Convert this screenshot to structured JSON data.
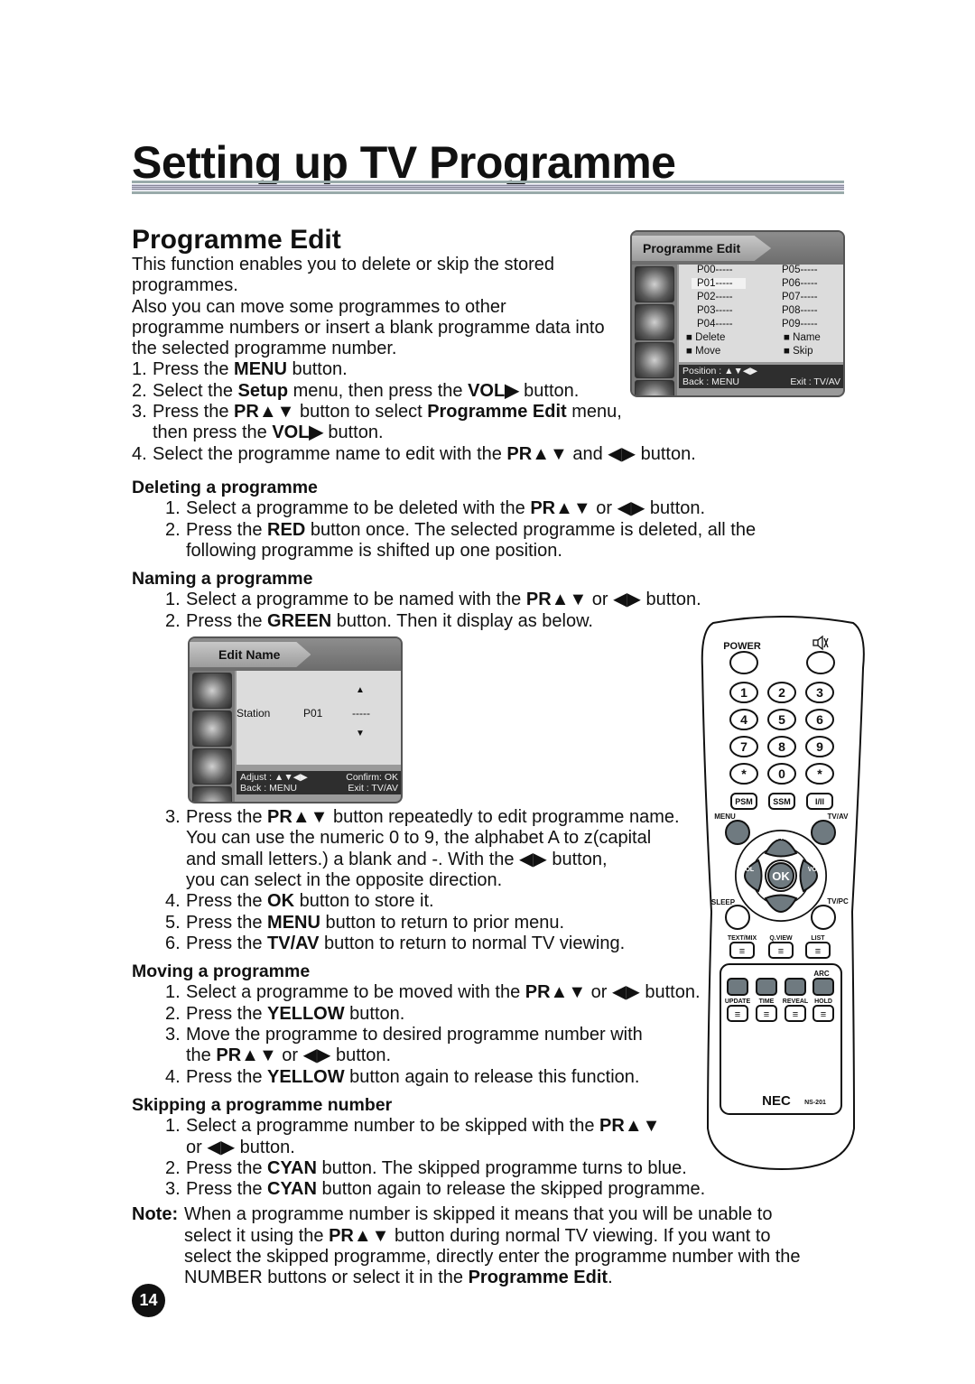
{
  "page_title": "Setting up TV Programme",
  "section_title": "Programme Edit",
  "page_number": "14",
  "body": [
    {
      "type": "para",
      "lines": [
        [
          {
            "t": "This function enables you to delete or skip the stored"
          }
        ],
        [
          {
            "t": "programmes."
          }
        ],
        [
          {
            "t": "Also you can move some programmes to other"
          }
        ],
        [
          {
            "t": "programme numbers or insert a blank programme data into"
          }
        ],
        [
          {
            "t": "the selected programme number."
          }
        ]
      ]
    },
    {
      "type": "list",
      "level": 0,
      "items": [
        {
          "num": "1.",
          "lines": [
            [
              {
                "t": "Press the "
              },
              {
                "t": "MENU",
                "b": true
              },
              {
                "t": " button."
              }
            ]
          ]
        },
        {
          "num": "2.",
          "lines": [
            [
              {
                "t": "Select the "
              },
              {
                "t": "Setup",
                "b": true
              },
              {
                "t": " menu, then press the "
              },
              {
                "t": "VOL▶",
                "b": true
              },
              {
                "t": " button."
              }
            ]
          ]
        },
        {
          "num": "3.",
          "lines": [
            [
              {
                "t": "Press the "
              },
              {
                "t": "PR▲▼",
                "b": true
              },
              {
                "t": " button to select "
              },
              {
                "t": "Programme Edit",
                "b": true
              },
              {
                "t": " menu,"
              }
            ],
            [
              {
                "t": "then press the "
              },
              {
                "t": "VOL▶",
                "b": true
              },
              {
                "t": " button."
              }
            ]
          ]
        },
        {
          "num": "4.",
          "lines": [
            [
              {
                "t": "Select the programme name to edit with the "
              },
              {
                "t": "PR▲▼",
                "b": true
              },
              {
                "t": " and ◀▶ button."
              }
            ]
          ]
        }
      ]
    },
    {
      "type": "heading",
      "text": "Deleting a programme"
    },
    {
      "type": "list",
      "level": 1,
      "items": [
        {
          "num": "1.",
          "lines": [
            [
              {
                "t": "Select a programme to be deleted with the "
              },
              {
                "t": "PR▲▼",
                "b": true
              },
              {
                "t": " or ◀▶ button."
              }
            ]
          ]
        },
        {
          "num": "2.",
          "lines": [
            [
              {
                "t": "Press the "
              },
              {
                "t": "RED",
                "b": true
              },
              {
                "t": " button once. The selected programme is deleted, all the"
              }
            ],
            [
              {
                "t": "following programme is shifted up one position."
              }
            ]
          ]
        }
      ]
    },
    {
      "type": "heading",
      "text": "Naming a programme",
      "tight": true
    },
    {
      "type": "list",
      "level": 1,
      "items": [
        {
          "num": "1.",
          "lines": [
            [
              {
                "t": "Select a programme to be named with the "
              },
              {
                "t": "PR▲▼",
                "b": true
              },
              {
                "t": " or ◀▶ button."
              }
            ]
          ]
        },
        {
          "num": "2.",
          "lines": [
            [
              {
                "t": "Press the "
              },
              {
                "t": "GREEN",
                "b": true
              },
              {
                "t": " button. Then it display as below."
              }
            ]
          ]
        }
      ]
    },
    {
      "type": "figure"
    },
    {
      "type": "list",
      "level": 1,
      "items": [
        {
          "num": "3.",
          "lines": [
            [
              {
                "t": "Press the "
              },
              {
                "t": "PR▲▼",
                "b": true
              },
              {
                "t": " button repeatedly to edit programme name."
              }
            ],
            [
              {
                "t": "You can use the numeric 0 to 9, the alphabet A to z(capital"
              }
            ],
            [
              {
                "t": "and small letters.) a blank and -. With the ◀▶ button,"
              }
            ],
            [
              {
                "t": "you can select in the opposite direction."
              }
            ]
          ]
        },
        {
          "num": "4.",
          "lines": [
            [
              {
                "t": "Press the "
              },
              {
                "t": "OK",
                "b": true
              },
              {
                "t": " button to store it."
              }
            ]
          ]
        },
        {
          "num": "5.",
          "lines": [
            [
              {
                "t": "Press the "
              },
              {
                "t": "MENU",
                "b": true
              },
              {
                "t": " button to return to prior menu."
              }
            ]
          ]
        },
        {
          "num": "6.",
          "lines": [
            [
              {
                "t": "Press the "
              },
              {
                "t": "TV/AV",
                "b": true
              },
              {
                "t": " button to return to normal TV viewing."
              }
            ]
          ]
        }
      ]
    },
    {
      "type": "heading",
      "text": "Moving a programme",
      "tight": true
    },
    {
      "type": "list",
      "level": 1,
      "items": [
        {
          "num": "1.",
          "lines": [
            [
              {
                "t": "Select a programme to be moved with the "
              },
              {
                "t": "PR▲▼",
                "b": true
              },
              {
                "t": " or ◀▶ button."
              }
            ]
          ]
        },
        {
          "num": "2.",
          "lines": [
            [
              {
                "t": "Press the "
              },
              {
                "t": "YELLOW",
                "b": true
              },
              {
                "t": " button."
              }
            ]
          ]
        },
        {
          "num": "3.",
          "lines": [
            [
              {
                "t": "Move the programme to desired programme number with"
              }
            ],
            [
              {
                "t": "the "
              },
              {
                "t": "PR▲▼",
                "b": true
              },
              {
                "t": " or ◀▶ button."
              }
            ]
          ]
        },
        {
          "num": "4.",
          "lines": [
            [
              {
                "t": "Press the "
              },
              {
                "t": "YELLOW",
                "b": true
              },
              {
                "t": " button again to release this function."
              }
            ]
          ]
        }
      ]
    },
    {
      "type": "heading",
      "text": "Skipping a programme number",
      "tight": true
    },
    {
      "type": "list",
      "level": 1,
      "items": [
        {
          "num": "1.",
          "lines": [
            [
              {
                "t": "Select a programme number to be skipped with the "
              },
              {
                "t": "PR▲▼",
                "b": true
              }
            ],
            [
              {
                "t": "or ◀▶ button."
              }
            ]
          ]
        },
        {
          "num": "2.",
          "lines": [
            [
              {
                "t": "Press the "
              },
              {
                "t": "CYAN",
                "b": true
              },
              {
                "t": " button. The skipped programme turns to blue."
              }
            ]
          ]
        },
        {
          "num": "3.",
          "lines": [
            [
              {
                "t": "Press the "
              },
              {
                "t": "CYAN",
                "b": true
              },
              {
                "t": " button again to release the skipped programme."
              }
            ]
          ]
        }
      ]
    },
    {
      "type": "note",
      "label": "Note:",
      "lines": [
        [
          {
            "t": "When a programme number is skipped it means that you will be unable to"
          }
        ],
        [
          {
            "t": "select it using the "
          },
          {
            "t": "PR▲▼",
            "b": true
          },
          {
            "t": " button during normal TV viewing. If you want to"
          }
        ],
        [
          {
            "t": "select the skipped programme, directly enter the programme number with the"
          }
        ],
        [
          {
            "t": "NUMBER buttons or select it in the "
          },
          {
            "t": "Programme Edit",
            "b": true
          },
          {
            "t": "."
          }
        ]
      ]
    }
  ],
  "programme_edit_menu": {
    "title": "Programme Edit",
    "left_column": [
      "P00-----",
      "P01-----",
      "P02-----",
      "P03-----",
      "P04-----"
    ],
    "right_column": [
      "P05-----",
      "P06-----",
      "P07-----",
      "P08-----",
      "P09-----"
    ],
    "selected": "P01-----",
    "actions": [
      "■ Delete",
      "■ Name",
      "■ Move",
      "■ Skip"
    ],
    "footer": {
      "position": "Position : ▲▼◀▶",
      "back": "Back : MENU",
      "exit": "Exit : TV/AV"
    }
  },
  "edit_name_menu": {
    "title": "Edit Name",
    "up": "▲",
    "down": "▼",
    "label": "Station",
    "programme": "P01",
    "name": "-----",
    "footer": {
      "adjust": "Adjust : ▲▼◀▶",
      "confirm": "Confirm: OK",
      "back": "Back : MENU",
      "exit": "Exit : TV/AV"
    }
  },
  "remote": {
    "power": "POWER",
    "mute_icon": "mute-icon",
    "numbers": [
      "1",
      "2",
      "3",
      "4",
      "5",
      "6",
      "7",
      "8",
      "9",
      "*",
      "0",
      "*"
    ],
    "func": [
      "PSM",
      "SSM",
      "I/II"
    ],
    "menu": "MENU",
    "tvav": "TV/AV",
    "sleep": "SLEEP",
    "tvpc": "TV/PC",
    "pr": "PR",
    "vol": "VOL",
    "ok": "OK",
    "text_labels": [
      "TEXT/MIX",
      "Q.VIEW",
      "LIST"
    ],
    "arc": "ARC",
    "teletext_labels": [
      "UPDATE",
      "TIME",
      "REVEAL",
      "HOLD"
    ],
    "brand": "NEC",
    "model": "NS-201",
    "colors": {
      "button_gray": "#6f7a80",
      "outline": "#111111"
    }
  }
}
